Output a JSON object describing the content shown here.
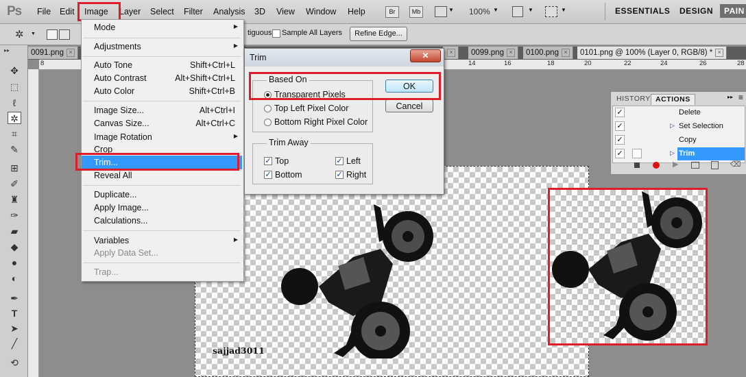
{
  "app": {
    "logo": "Ps"
  },
  "menubar": {
    "items": [
      "File",
      "Edit",
      "Image",
      "Layer",
      "Select",
      "Filter",
      "Analysis",
      "3D",
      "View",
      "Window",
      "Help"
    ],
    "badges": [
      "Br",
      "Mb"
    ],
    "zoom": "100%",
    "workspaces": [
      "ESSENTIALS",
      "DESIGN",
      "PAIN"
    ]
  },
  "options": {
    "contiguous": "tiguous",
    "sample_all_layers": "Sample All Layers",
    "refine_edge": "Refine Edge..."
  },
  "tabs": [
    {
      "label": "0091.png"
    },
    {
      "label": "0099.png"
    },
    {
      "label": "0100.png"
    },
    {
      "label": "0101.png @ 100% (Layer 0, RGB/8) *"
    }
  ],
  "ruler": {
    "h_labels": [
      "8",
      "14",
      "16",
      "18",
      "20",
      "22",
      "24",
      "26",
      "28"
    ]
  },
  "image_menu": {
    "mode": "Mode",
    "adjustments": "Adjustments",
    "auto_tone": "Auto Tone",
    "auto_tone_sc": "Shift+Ctrl+L",
    "auto_contrast": "Auto Contrast",
    "auto_contrast_sc": "Alt+Shift+Ctrl+L",
    "auto_color": "Auto Color",
    "auto_color_sc": "Shift+Ctrl+B",
    "image_size": "Image Size...",
    "image_size_sc": "Alt+Ctrl+I",
    "canvas_size": "Canvas Size...",
    "canvas_size_sc": "Alt+Ctrl+C",
    "image_rotation": "Image Rotation",
    "crop": "Crop",
    "trim": "Trim...",
    "reveal_all": "Reveal All",
    "duplicate": "Duplicate...",
    "apply_image": "Apply Image...",
    "calculations": "Calculations...",
    "variables": "Variables",
    "apply_data_set": "Apply Data Set...",
    "trap": "Trap..."
  },
  "trim_dialog": {
    "title": "Trim",
    "based_on": "Based On",
    "transparent_pixels": "Transparent Pixels",
    "top_left_pixel_color": "Top Left Pixel Color",
    "bottom_right_pixel_color": "Bottom Right Pixel Color",
    "trim_away": "Trim Away",
    "top": "Top",
    "bottom": "Bottom",
    "left": "Left",
    "right": "Right",
    "ok": "OK",
    "cancel": "Cancel"
  },
  "actions_panel": {
    "tabs": [
      "HISTORY",
      "ACTIONS"
    ],
    "rows": [
      "Delete",
      "Set Selection",
      "Copy",
      "Trim"
    ]
  },
  "canvas": {
    "watermark": "sajjad3011"
  },
  "colors": {
    "highlight": "#3399ff",
    "annotation_red": "#e01c2a"
  }
}
